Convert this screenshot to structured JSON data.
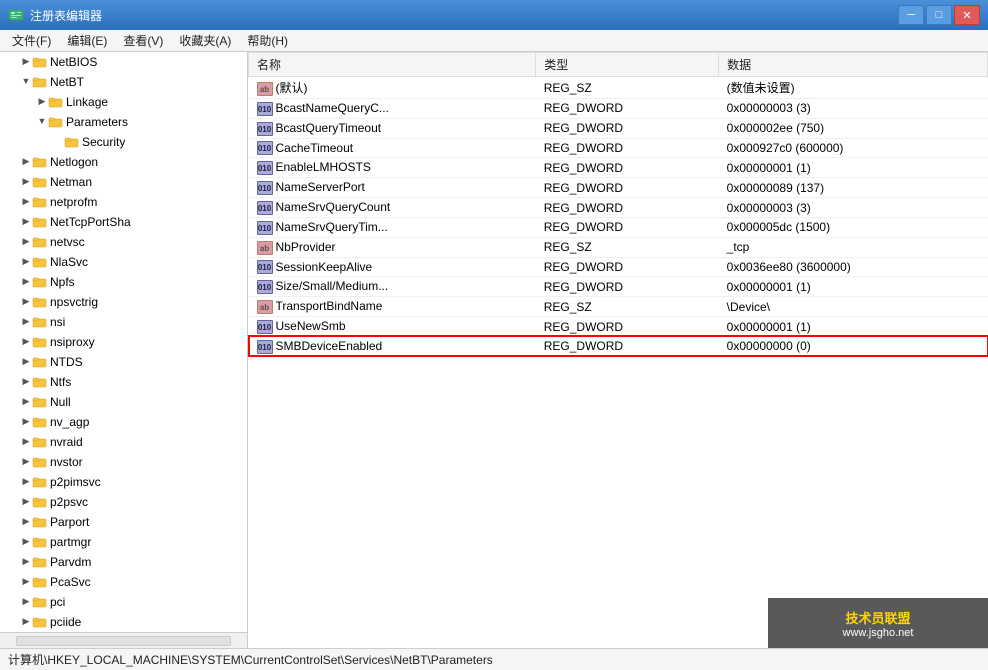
{
  "window": {
    "title": "注册表编辑器",
    "icon": "regedit"
  },
  "titleControls": {
    "minimize": "─",
    "maximize": "□",
    "close": "✕"
  },
  "menuBar": {
    "items": [
      "文件(F)",
      "编辑(E)",
      "查看(V)",
      "收藏夹(A)",
      "帮助(H)"
    ]
  },
  "tree": {
    "items": [
      {
        "id": "NetBIOS",
        "label": "NetBIOS",
        "indent": 1,
        "expanded": false,
        "arrow": "▶"
      },
      {
        "id": "NetBT",
        "label": "NetBT",
        "indent": 1,
        "expanded": true,
        "arrow": "▼",
        "selected": false
      },
      {
        "id": "Linkage",
        "label": "Linkage",
        "indent": 2,
        "expanded": false,
        "arrow": "▶"
      },
      {
        "id": "Parameters",
        "label": "Parameters",
        "indent": 2,
        "expanded": true,
        "arrow": "▼"
      },
      {
        "id": "Security",
        "label": "Security",
        "indent": 3,
        "expanded": false,
        "arrow": ""
      },
      {
        "id": "Netlogon",
        "label": "Netlogon",
        "indent": 1,
        "expanded": false,
        "arrow": "▶"
      },
      {
        "id": "Netman",
        "label": "Netman",
        "indent": 1,
        "expanded": false,
        "arrow": "▶"
      },
      {
        "id": "netprofm",
        "label": "netprofm",
        "indent": 1,
        "expanded": false,
        "arrow": "▶"
      },
      {
        "id": "NetTcpPortSha",
        "label": "NetTcpPortSha",
        "indent": 1,
        "expanded": false,
        "arrow": "▶"
      },
      {
        "id": "netvsc",
        "label": "netvsc",
        "indent": 1,
        "expanded": false,
        "arrow": "▶"
      },
      {
        "id": "NlaSvc",
        "label": "NlaSvc",
        "indent": 1,
        "expanded": false,
        "arrow": "▶"
      },
      {
        "id": "Npfs",
        "label": "Npfs",
        "indent": 1,
        "expanded": false,
        "arrow": "▶"
      },
      {
        "id": "npsvctrig",
        "label": "npsvctrig",
        "indent": 1,
        "expanded": false,
        "arrow": "▶"
      },
      {
        "id": "nsi",
        "label": "nsi",
        "indent": 1,
        "expanded": false,
        "arrow": "▶"
      },
      {
        "id": "nsiproxy",
        "label": "nsiproxy",
        "indent": 1,
        "expanded": false,
        "arrow": "▶"
      },
      {
        "id": "NTDS",
        "label": "NTDS",
        "indent": 1,
        "expanded": false,
        "arrow": "▶"
      },
      {
        "id": "Ntfs",
        "label": "Ntfs",
        "indent": 1,
        "expanded": false,
        "arrow": "▶"
      },
      {
        "id": "Null",
        "label": "Null",
        "indent": 1,
        "expanded": false,
        "arrow": "▶"
      },
      {
        "id": "nv_agp",
        "label": "nv_agp",
        "indent": 1,
        "expanded": false,
        "arrow": "▶"
      },
      {
        "id": "nvraid",
        "label": "nvraid",
        "indent": 1,
        "expanded": false,
        "arrow": "▶"
      },
      {
        "id": "nvstor",
        "label": "nvstor",
        "indent": 1,
        "expanded": false,
        "arrow": "▶"
      },
      {
        "id": "p2pimsvc",
        "label": "p2pimsvc",
        "indent": 1,
        "expanded": false,
        "arrow": "▶"
      },
      {
        "id": "p2psvc",
        "label": "p2psvc",
        "indent": 1,
        "expanded": false,
        "arrow": "▶"
      },
      {
        "id": "Parport",
        "label": "Parport",
        "indent": 1,
        "expanded": false,
        "arrow": "▶"
      },
      {
        "id": "partmgr",
        "label": "partmgr",
        "indent": 1,
        "expanded": false,
        "arrow": "▶"
      },
      {
        "id": "Parvdm",
        "label": "Parvdm",
        "indent": 1,
        "expanded": false,
        "arrow": "▶"
      },
      {
        "id": "PcaSvc",
        "label": "PcaSvc",
        "indent": 1,
        "expanded": false,
        "arrow": "▶"
      },
      {
        "id": "pci",
        "label": "pci",
        "indent": 1,
        "expanded": false,
        "arrow": "▶"
      },
      {
        "id": "pciide",
        "label": "pciide",
        "indent": 1,
        "expanded": false,
        "arrow": "▶"
      }
    ]
  },
  "columns": {
    "name": "名称",
    "type": "类型",
    "data": "数据"
  },
  "tableRows": [
    {
      "id": "default",
      "name": "(默认)",
      "type": "REG_SZ",
      "data": "(数值未设置)",
      "iconType": "sz",
      "highlighted": false,
      "selected": false
    },
    {
      "id": "BcastNameQueryC",
      "name": "BcastNameQueryC...",
      "type": "REG_DWORD",
      "data": "0x00000003 (3)",
      "iconType": "dword",
      "highlighted": false,
      "selected": false
    },
    {
      "id": "BcastQueryTimeout",
      "name": "BcastQueryTimeout",
      "type": "REG_DWORD",
      "data": "0x000002ee (750)",
      "iconType": "dword",
      "highlighted": false,
      "selected": false
    },
    {
      "id": "CacheTimeout",
      "name": "CacheTimeout",
      "type": "REG_DWORD",
      "data": "0x000927c0 (600000)",
      "iconType": "dword",
      "highlighted": false,
      "selected": false
    },
    {
      "id": "EnableLMHOSTS",
      "name": "EnableLMHOSTS",
      "type": "REG_DWORD",
      "data": "0x00000001 (1)",
      "iconType": "dword",
      "highlighted": false,
      "selected": false
    },
    {
      "id": "NameServerPort",
      "name": "NameServerPort",
      "type": "REG_DWORD",
      "data": "0x00000089 (137)",
      "iconType": "dword",
      "highlighted": false,
      "selected": false
    },
    {
      "id": "NameSrvQueryCount",
      "name": "NameSrvQueryCount",
      "type": "REG_DWORD",
      "data": "0x00000003 (3)",
      "iconType": "dword",
      "highlighted": false,
      "selected": false
    },
    {
      "id": "NameSrvQueryTim",
      "name": "NameSrvQueryTim...",
      "type": "REG_DWORD",
      "data": "0x000005dc (1500)",
      "iconType": "dword",
      "highlighted": false,
      "selected": false
    },
    {
      "id": "NbProvider",
      "name": "NbProvider",
      "type": "REG_SZ",
      "data": "_tcp",
      "iconType": "sz",
      "highlighted": false,
      "selected": false
    },
    {
      "id": "SessionKeepAlive",
      "name": "SessionKeepAlive",
      "type": "REG_DWORD",
      "data": "0x0036ee80 (3600000)",
      "iconType": "dword",
      "highlighted": false,
      "selected": false
    },
    {
      "id": "SizeSmallMedium",
      "name": "Size/Small/Medium...",
      "type": "REG_DWORD",
      "data": "0x00000001 (1)",
      "iconType": "dword",
      "highlighted": false,
      "selected": false
    },
    {
      "id": "TransportBindName",
      "name": "TransportBindName",
      "type": "REG_SZ",
      "data": "\\Device\\",
      "iconType": "sz",
      "highlighted": false,
      "selected": false
    },
    {
      "id": "UseNewSmb",
      "name": "UseNewSmb",
      "type": "REG_DWORD",
      "data": "0x00000001 (1)",
      "iconType": "dword",
      "highlighted": false,
      "selected": false
    },
    {
      "id": "SMBDeviceEnabled",
      "name": "SMBDeviceEnabled",
      "type": "REG_DWORD",
      "data": "0x00000000 (0)",
      "iconType": "dword",
      "highlighted": true,
      "selected": false
    }
  ],
  "statusBar": {
    "path": "计算机\\HKEY_LOCAL_MACHINE\\SYSTEM\\CurrentControlSet\\Services\\NetBT\\Parameters"
  },
  "watermark": {
    "line1": "技术员联盟",
    "line2": "www.jsgho.net"
  }
}
